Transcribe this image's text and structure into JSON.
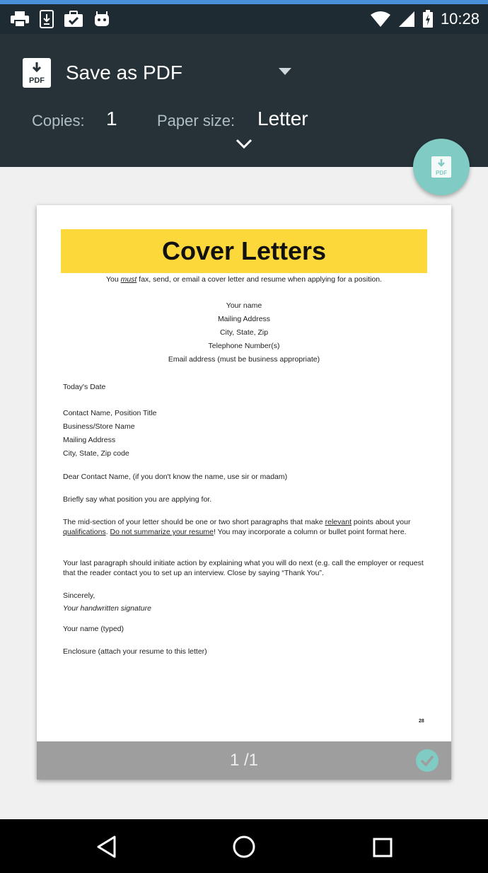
{
  "status_bar": {
    "time": "10:28",
    "icons": [
      "print-icon",
      "download-icon",
      "briefcase-icon",
      "android-icon",
      "wifi-icon",
      "signal-icon",
      "battery-icon"
    ]
  },
  "print_dialog": {
    "destination": "Save as PDF",
    "copies_label": "Copies:",
    "copies_value": "1",
    "paper_size_label": "Paper size:",
    "paper_size_value": "Letter",
    "pdf_badge_text": "PDF",
    "colors": {
      "header": "#263238",
      "fab": "#80cbc4",
      "accent_check": "#80cbc4"
    }
  },
  "preview": {
    "title": "Cover Letters",
    "intro": {
      "pre": "You ",
      "emph": "must",
      "post": " fax, send, or email a cover letter and resume when applying for a position."
    },
    "address_block": [
      "Your name",
      "Mailing Address",
      "City, State, Zip",
      "Telephone Number(s)",
      "Email address (must be business appropriate)"
    ],
    "date": "Today's Date",
    "recipient_block": [
      "Contact Name, Position Title",
      "Business/Store Name",
      "Mailing Address",
      "City, State, Zip code"
    ],
    "salutation": "Dear Contact Name, (if you don't know the name, use sir or madam)",
    "para1": "Briefly say what position you are applying for.",
    "para2": {
      "a": "The mid-section of your letter should be one or two short paragraphs that make ",
      "b": "relevant",
      "c": " points about your ",
      "d": "qualifications",
      "e": ".  ",
      "f": "Do not summarize your resume",
      "g": "!  You may incorporate a column or bullet point format here."
    },
    "para3": "Your last paragraph should initiate action by explaining what you will do next (e.g. call the employer or request that the reader contact you to set up an interview.  Close by saying “Thank You”.",
    "closing": "Sincerely,",
    "signature": "Your handwritten signature",
    "typed_name": "Your name (typed)",
    "enclosure": "Enclosure (attach your resume to this letter)",
    "page_marker": "28",
    "page_indicator": "1 /1"
  }
}
